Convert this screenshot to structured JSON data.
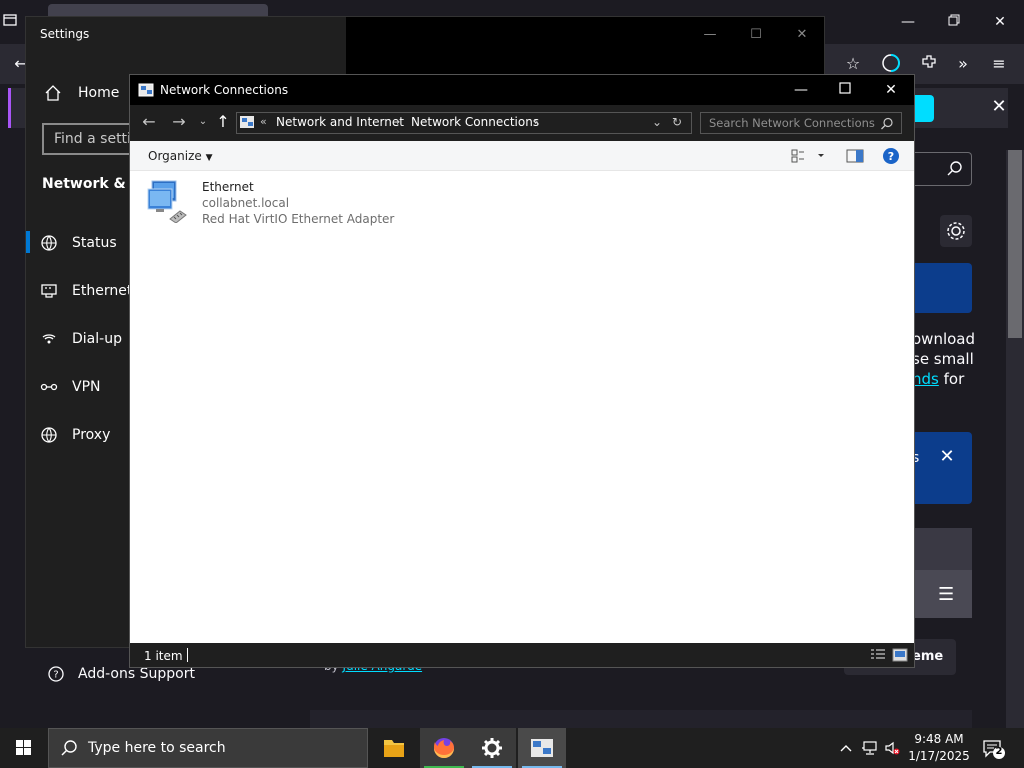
{
  "browser": {
    "bg_text": {
      "line1": "ownload",
      "line2": "se small",
      "line3_link": "nds",
      "line3_rest": " for"
    },
    "notice_text": "s",
    "theme_label": "eme",
    "by_prefix": "by ",
    "by_author": "Julie Angarde",
    "addons_label": "Add-ons Support"
  },
  "settings": {
    "title": "Settings",
    "home_label": "Home",
    "search_placeholder": "Find a setting",
    "section_title": "Network & Internet",
    "nav": [
      {
        "label": "Status",
        "icon": "globe-status-icon"
      },
      {
        "label": "Ethernet",
        "icon": "ethernet-icon"
      },
      {
        "label": "Dial-up",
        "icon": "dialup-icon"
      },
      {
        "label": "VPN",
        "icon": "vpn-icon"
      },
      {
        "label": "Proxy",
        "icon": "globe-icon"
      }
    ]
  },
  "network": {
    "title": "Network Connections",
    "breadcrumb": {
      "overflow": "«",
      "items": [
        "Network and Internet",
        "Network Connections"
      ]
    },
    "search_placeholder": "Search Network Connections",
    "organize_label": "Organize",
    "item": {
      "name": "Ethernet",
      "domain": "collabnet.local",
      "adapter": "Red Hat VirtIO Ethernet Adapter"
    },
    "status_count": "1 item"
  },
  "taskbar": {
    "search_placeholder": "Type here to search",
    "time": "9:48 AM",
    "date": "1/17/2025",
    "notification_count": "2"
  },
  "colors": {
    "accent_blue": "#0078d4",
    "firefox_cyan": "#00ddff",
    "dark_surface": "#1f1f1f"
  }
}
